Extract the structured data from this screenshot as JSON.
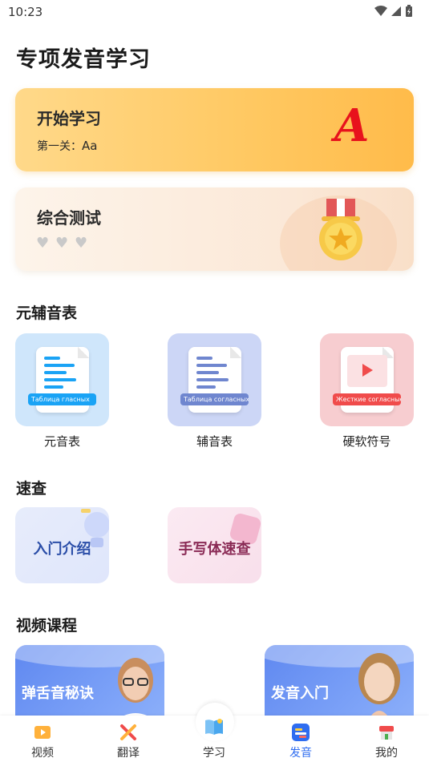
{
  "status_bar": {
    "time": "10:23"
  },
  "page": {
    "title": "专项发音学习"
  },
  "start_card": {
    "title": "开始学习",
    "level_prefix": "第一关：",
    "level_value": "Aa",
    "letter": "A"
  },
  "test_card": {
    "title": "综合测试",
    "hearts": 3
  },
  "vowel_section": {
    "title": "元辅音表",
    "tiles": [
      {
        "label": "元音表",
        "tag": "Таблица гласных",
        "accent": "#1aa3f5"
      },
      {
        "label": "辅音表",
        "tag": "Таблица согласных",
        "accent": "#6f86cf"
      },
      {
        "label": "硬软符号",
        "tag": "Жесткие согласные",
        "accent": "#f04b4b"
      }
    ]
  },
  "quick_section": {
    "title": "速查",
    "tiles": [
      {
        "label": "入门介绍",
        "color": "#2b4ea8"
      },
      {
        "label": "手写体速查",
        "color": "#8a2a55"
      }
    ]
  },
  "video_section": {
    "title": "视频课程",
    "courses": [
      {
        "label": "弹舌音秘诀"
      },
      {
        "label": "发音入门"
      }
    ]
  },
  "tabbar": {
    "tabs": [
      {
        "label": "视频",
        "icon": "video-icon"
      },
      {
        "label": "翻译",
        "icon": "translate-icon"
      },
      {
        "label": "学习",
        "icon": "book-icon"
      },
      {
        "label": "发音",
        "icon": "pronunciation-icon",
        "active": true
      },
      {
        "label": "我的",
        "icon": "shop-icon"
      }
    ],
    "active_color": "#2f6df0"
  }
}
